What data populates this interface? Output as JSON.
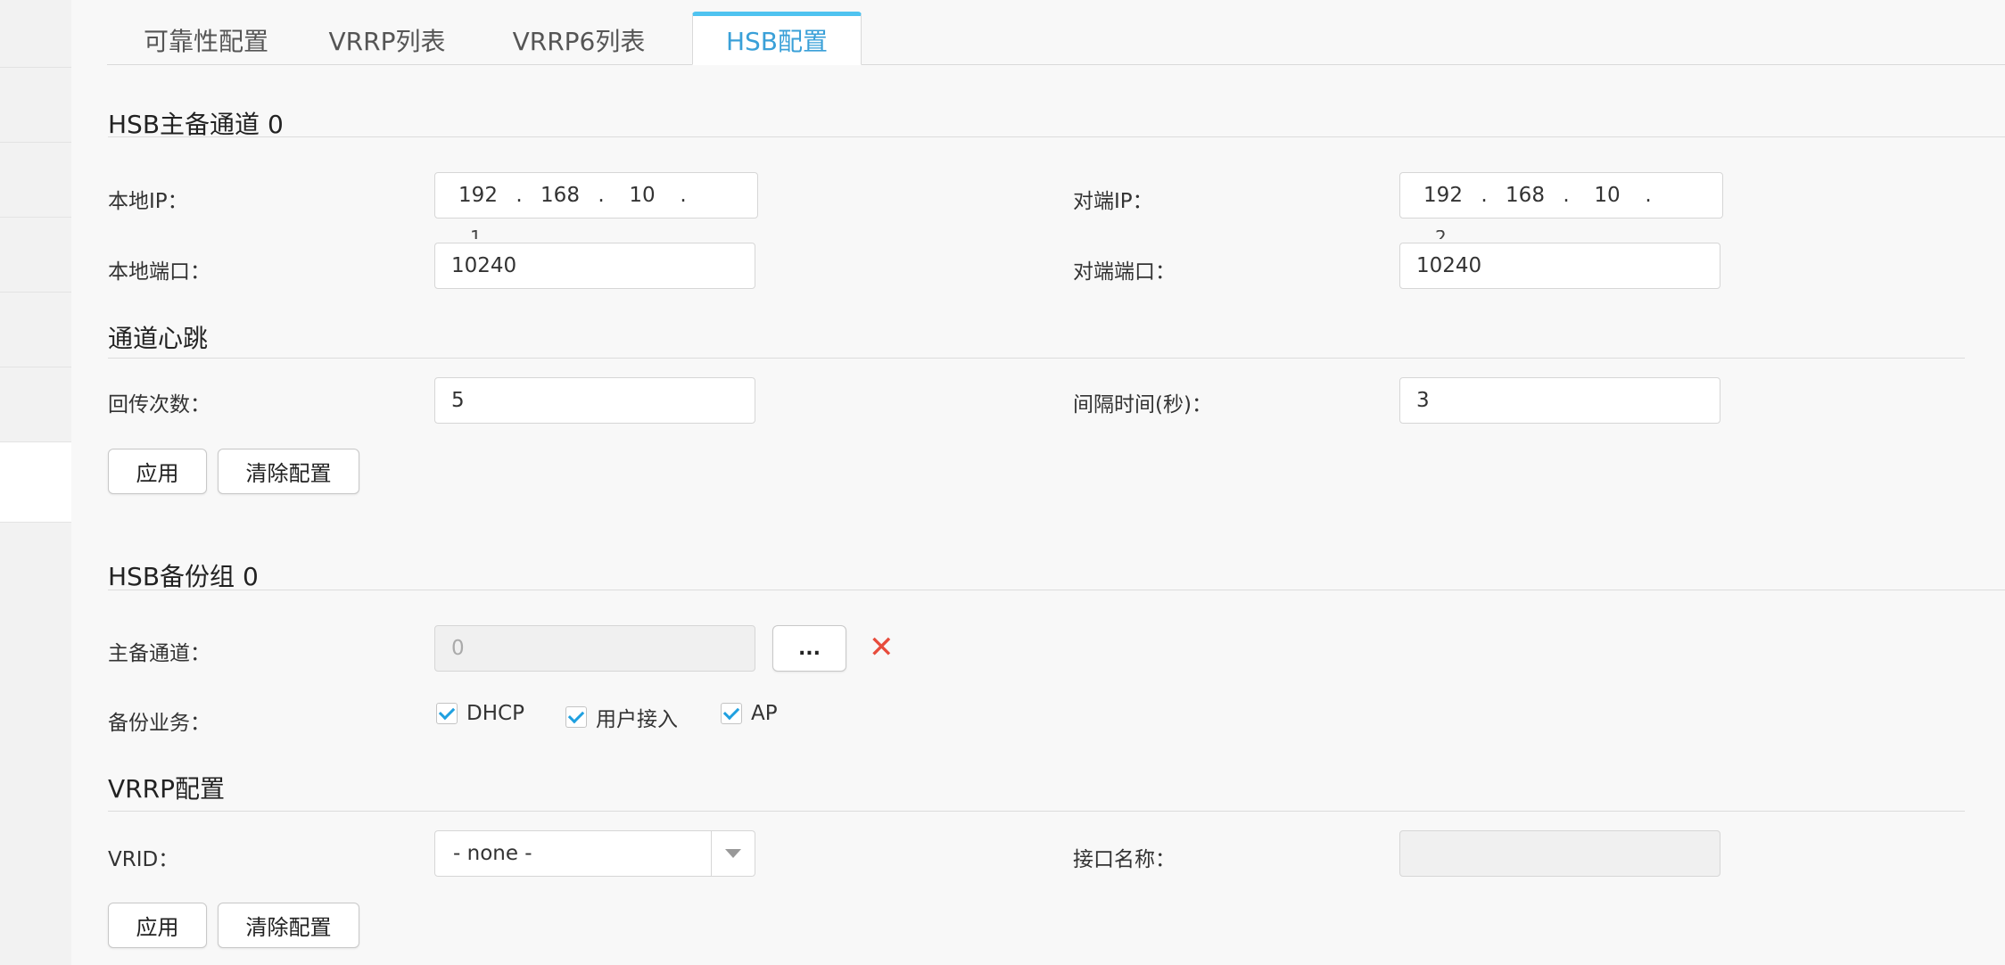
{
  "tabs": [
    {
      "label": "可靠性配置"
    },
    {
      "label": "VRRP列表"
    },
    {
      "label": "VRRP6列表"
    },
    {
      "label": "HSB配置"
    }
  ],
  "hsb_channel": {
    "title": "HSB主备通道 0",
    "local_ip_label": "本地IP：",
    "local_ip": [
      "192",
      "168",
      "10",
      "1"
    ],
    "peer_ip_label": "对端IP：",
    "peer_ip": [
      "192",
      "168",
      "10",
      "2"
    ],
    "local_port_label": "本地端口：",
    "local_port": "10240",
    "peer_port_label": "对端端口：",
    "peer_port": "10240"
  },
  "heartbeat": {
    "title": "通道心跳",
    "retries_label": "回传次数：",
    "retries": "5",
    "interval_label": "间隔时间(秒)：",
    "interval": "3"
  },
  "buttons": {
    "apply": "应用",
    "clear": "清除配置",
    "browse": "..."
  },
  "hsb_backup": {
    "title": "HSB备份组 0",
    "channel_label": "主备通道：",
    "channel_value": "0",
    "services_label": "备份业务：",
    "services": [
      {
        "label": "DHCP",
        "checked": true
      },
      {
        "label": "用户接入",
        "checked": true
      },
      {
        "label": "AP",
        "checked": true
      }
    ]
  },
  "vrrp": {
    "title": "VRRP配置",
    "vrid_label": "VRID：",
    "vrid_value": "- none -",
    "iface_label": "接口名称：",
    "iface_value": ""
  },
  "icons": {
    "remove": "close-icon",
    "check": "check-icon",
    "dropdown": "chevron-down-icon"
  },
  "colors": {
    "accent": "#3aa0d8",
    "tab_indicator": "#4fc3f0",
    "remove": "#e74c3c"
  }
}
